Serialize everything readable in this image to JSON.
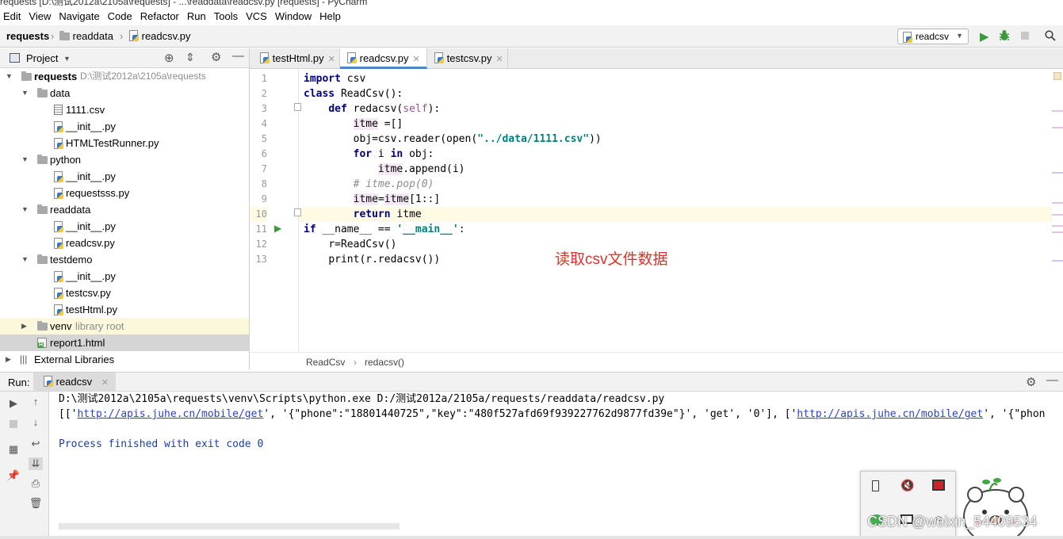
{
  "window": {
    "title": "requests [D:\\测试2012a\\2105a\\requests] - ...\\readdata\\readcsv.py [requests] - PyCharm"
  },
  "menu": [
    "Edit",
    "View",
    "Navigate",
    "Code",
    "Refactor",
    "Run",
    "Tools",
    "VCS",
    "Window",
    "Help"
  ],
  "breadcrumb": {
    "project": "requests",
    "folder": "readdata",
    "file": "readcsv.py"
  },
  "run_config": "readcsv",
  "project_panel": {
    "title": "Project",
    "root": {
      "name": "requests",
      "path": "D:\\测试2012a\\2105a\\requests"
    },
    "items": [
      {
        "label": "data"
      },
      {
        "label": "1111.csv"
      },
      {
        "label": "__init__.py"
      },
      {
        "label": "HTMLTestRunner.py"
      },
      {
        "label": "python"
      },
      {
        "label": "__init__.py"
      },
      {
        "label": "requestsss.py"
      },
      {
        "label": "readdata"
      },
      {
        "label": "__init__.py"
      },
      {
        "label": "readcsv.py"
      },
      {
        "label": "testdemo"
      },
      {
        "label": "__init__.py"
      },
      {
        "label": "testcsv.py"
      },
      {
        "label": "testHtml.py"
      },
      {
        "label": "venv"
      },
      {
        "label": "report1.html"
      },
      {
        "label": "External Libraries"
      }
    ],
    "venv_suffix": "library root"
  },
  "editor_tabs": [
    "testHtml.py",
    "readcsv.py",
    "testcsv.py"
  ],
  "line_numbers": [
    "1",
    "2",
    "3",
    "4",
    "5",
    "6",
    "7",
    "8",
    "9",
    "10",
    "11",
    "12",
    "13"
  ],
  "code": {
    "l1_kw": "import",
    "l1_rest": " csv",
    "l2_kw": "class",
    "l2_rest": " ReadCsv():",
    "l3_kw": "def",
    "l3_name": " redacsv(",
    "l3_self": "self",
    "l3_end": "):",
    "l4_var": "itme",
    "l4_rest": " =[]",
    "l5_a": "obj=csv.reader(open(",
    "l5_str": "\"../data/1111.csv\"",
    "l5_b": "))",
    "l6_kw": "for",
    "l6_mid": " i ",
    "l6_kw2": "in",
    "l6_rest": " obj:",
    "l7_var": "itme",
    "l7_rest": ".append(i)",
    "l8": "# itme.pop(0)",
    "l9_var1": "itme",
    "l9_eq": "=",
    "l9_var2": "itme",
    "l9_rest": "[1::]",
    "l10_kw": "return",
    "l10_rest": " itme",
    "l11_kw": "if",
    "l11_mid": " __name__ == ",
    "l11_str": "'__main__'",
    "l11_end": ":",
    "l12": "r=ReadCsv()",
    "l13": "print(r.redacsv())"
  },
  "annotation": "读取csv文件数据",
  "editor_breadcrumb": {
    "cls": "ReadCsv",
    "method": "redacsv()"
  },
  "run_panel": {
    "label": "Run:",
    "tab": "readcsv",
    "line1": "D:\\测试2012a\\2105a\\requests\\venv\\Scripts\\python.exe D:/测试2012a/2105a/requests/readdata/readcsv.py",
    "line2_a": "[['",
    "link1": "http://apis.juhe.cn/mobile/get",
    "line2_b": "', '{\"phone\":\"18801440725\",\"key\":\"480f527afd69f939227762d9877fd39e\"}', 'get', '0'], ['",
    "link2": "http://apis.juhe.cn/mobile/get",
    "line2_c": "', '{\"phon",
    "line3": "Process finished with exit code 0"
  },
  "watermark": "CSDN @weixin_54409534",
  "accent": "#4a88c7"
}
